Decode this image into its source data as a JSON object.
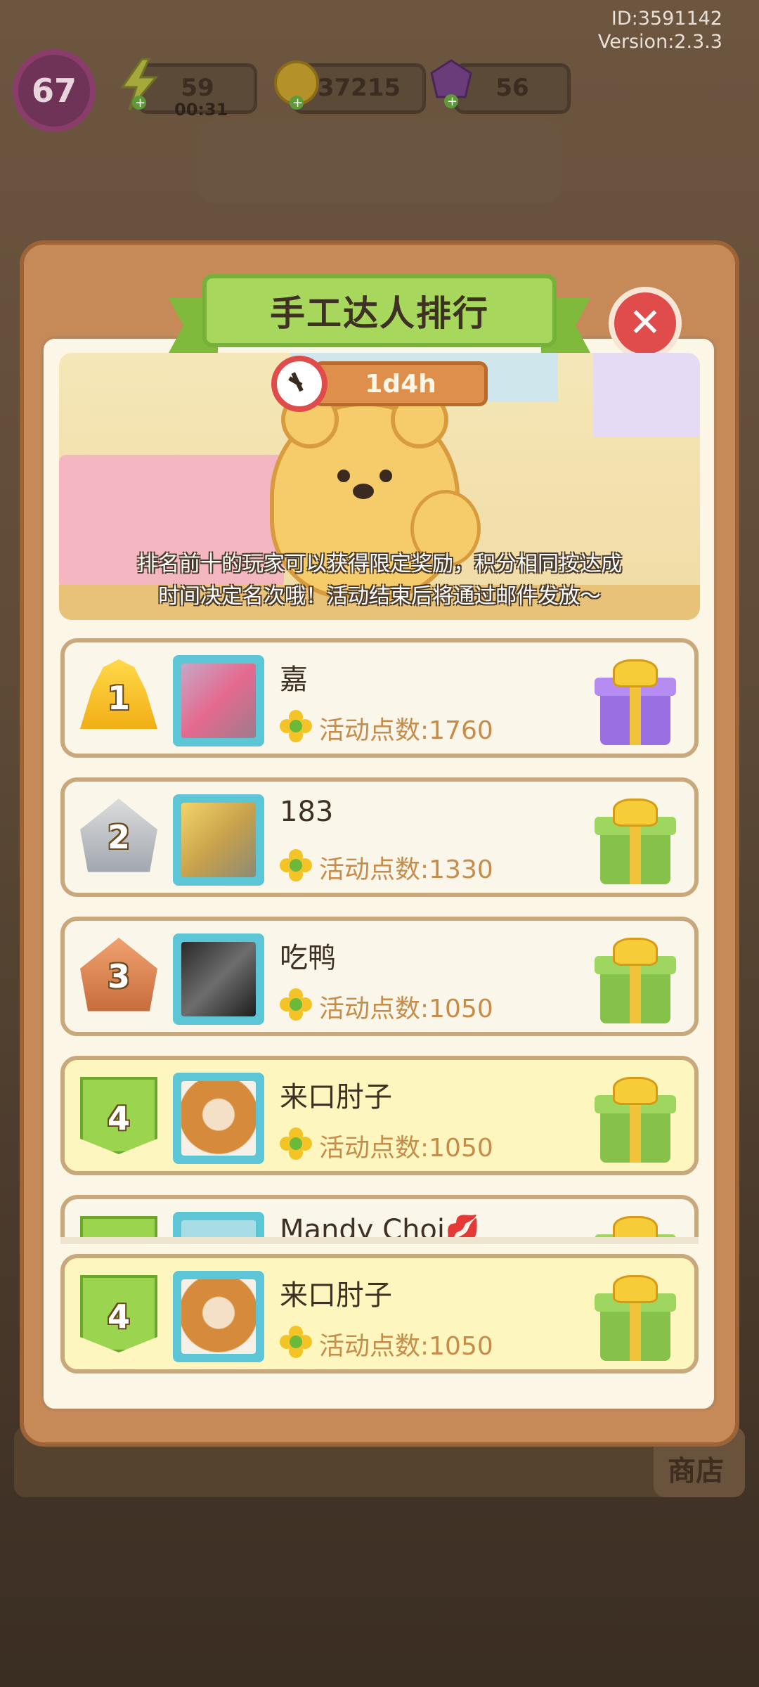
{
  "hud": {
    "id_label": "ID:3591142",
    "version_label": "Version:2.3.3",
    "level": "67",
    "energy": "59",
    "energy_timer": "00:31",
    "coins": "37215",
    "gems": "56"
  },
  "panel": {
    "title": "手工达人排行",
    "close_icon": "close-icon",
    "timer": "1d4h",
    "note_line1": "排名前十的玩家可以获得限定奖励，积分相同按达成",
    "note_line2": "时间决定名次哦！活动结束后将通过邮件发放～"
  },
  "rankings": [
    {
      "rank": "1",
      "name": "嘉",
      "points": "活动点数:1760",
      "gift": "purple"
    },
    {
      "rank": "2",
      "name": "183",
      "points": "活动点数:1330",
      "gift": "green"
    },
    {
      "rank": "3",
      "name": "吃鸭",
      "points": "活动点数:1050",
      "gift": "green"
    },
    {
      "rank": "4",
      "name": "来口肘子",
      "points": "活动点数:1050",
      "gift": "green"
    },
    {
      "rank": "",
      "name": "Mandy Choi💋",
      "points": "",
      "gift": "green"
    }
  ],
  "my_rank": {
    "rank": "4",
    "name": "来口肘子",
    "points": "活动点数:1050"
  },
  "background": {
    "shop_label": "商店"
  }
}
